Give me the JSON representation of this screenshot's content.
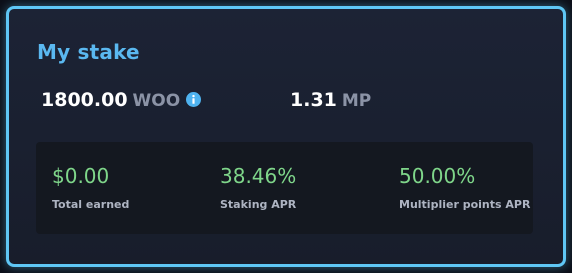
{
  "card": {
    "title": "My stake",
    "woo": {
      "amount": "1800.00",
      "unit": "WOO",
      "info_icon": "info-icon"
    },
    "mp": {
      "amount": "1.31",
      "unit": "MP"
    }
  },
  "stats": [
    {
      "value": "$0.00",
      "label": "Total earned"
    },
    {
      "value": "38.46%",
      "label": "Staking APR"
    },
    {
      "value": "50.00%",
      "label": "Multiplier points APR"
    }
  ],
  "colors": {
    "accent_border": "#5fc7f5",
    "title": "#5ab8f0",
    "positive": "#7fd68a",
    "info_icon": "#4fb3f0"
  }
}
